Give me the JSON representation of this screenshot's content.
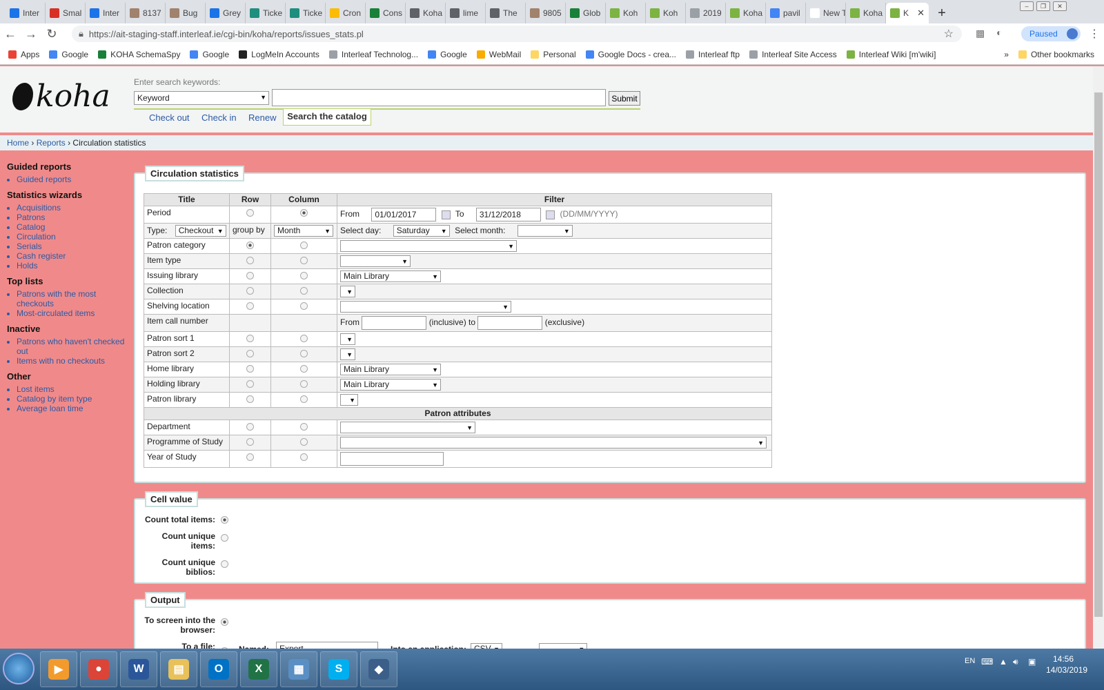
{
  "browser": {
    "tabs": [
      {
        "label": "Inter",
        "color": "#1a73e8"
      },
      {
        "label": "Smal",
        "color": "#d93025"
      },
      {
        "label": "Inter",
        "color": "#1a73e8"
      },
      {
        "label": "8137",
        "color": "#a0826d"
      },
      {
        "label": "Bug",
        "color": "#a0826d"
      },
      {
        "label": "Grey",
        "color": "#1a73e8"
      },
      {
        "label": "Ticke",
        "color": "#1e8e7e"
      },
      {
        "label": "Ticke",
        "color": "#1e8e7e"
      },
      {
        "label": "Cron",
        "color": "#fbbc04"
      },
      {
        "label": "Cons",
        "color": "#188038"
      },
      {
        "label": "Koha",
        "color": "#5f6368"
      },
      {
        "label": "lime",
        "color": "#5f6368"
      },
      {
        "label": "The",
        "color": "#5f6368"
      },
      {
        "label": "9805",
        "color": "#a0826d"
      },
      {
        "label": "Glob",
        "color": "#188038"
      },
      {
        "label": "Koh",
        "color": "#7cb342"
      },
      {
        "label": "Koh",
        "color": "#7cb342"
      },
      {
        "label": "2019",
        "color": "#9aa0a6"
      },
      {
        "label": "Koha",
        "color": "#7cb342"
      },
      {
        "label": "pavil",
        "color": "#4285f4"
      },
      {
        "label": "New Tab",
        "color": "#ffffff"
      },
      {
        "label": "Koha",
        "color": "#7cb342"
      }
    ],
    "active_tab": {
      "label": "K",
      "close": "✕"
    },
    "url": "https://ait-staging-staff.interleaf.ie/cgi-bin/koha/reports/issues_stats.pl",
    "paused_label": "Paused",
    "bookmarks": [
      {
        "label": "Apps",
        "icon": "apps-icon",
        "color": "#ea4335"
      },
      {
        "label": "Google",
        "icon": "google-icon",
        "color": "#4285f4"
      },
      {
        "label": "KOHA SchemaSpy",
        "icon": "koha-icon",
        "color": "#188038"
      },
      {
        "label": "Google",
        "icon": "google-icon",
        "color": "#4285f4"
      },
      {
        "label": "LogMeIn Accounts",
        "icon": "logmein-icon",
        "color": "#222222"
      },
      {
        "label": "Interleaf Technolog...",
        "icon": "page-icon",
        "color": "#9aa0a6"
      },
      {
        "label": "Google",
        "icon": "google-icon",
        "color": "#4285f4"
      },
      {
        "label": "WebMail",
        "icon": "webmail-icon",
        "color": "#f9ab00"
      },
      {
        "label": "Personal",
        "icon": "folder-icon",
        "color": "#fdd663"
      },
      {
        "label": "Google Docs - crea...",
        "icon": "docs-icon",
        "color": "#4285f4"
      },
      {
        "label": "Interleaf ftp",
        "icon": "page-icon",
        "color": "#9aa0a6"
      },
      {
        "label": "Interleaf Site Access",
        "icon": "page-icon",
        "color": "#9aa0a6"
      },
      {
        "label": "Interleaf Wiki [m'wiki]",
        "icon": "wiki-icon",
        "color": "#7cb342"
      }
    ],
    "other_bookmarks": "Other bookmarks",
    "more": "»"
  },
  "koha_header": {
    "logo_text": "koha",
    "search_label": "Enter search keywords:",
    "search_type": "Keyword",
    "submit_label": "Submit",
    "tabs": [
      "Check out",
      "Check in",
      "Renew"
    ],
    "active_tab": "Search the catalog"
  },
  "breadcrumb": {
    "home": "Home",
    "sep1": "›",
    "reports": "Reports",
    "sep2": "›",
    "current": "Circulation statistics"
  },
  "sidebar": {
    "sections": [
      {
        "heading": "Guided reports",
        "items": [
          "Guided reports"
        ]
      },
      {
        "heading": "Statistics wizards",
        "items": [
          "Acquisitions",
          "Patrons",
          "Catalog",
          "Circulation",
          "Serials",
          "Cash register",
          "Holds"
        ]
      },
      {
        "heading": "Top lists",
        "items": [
          "Patrons with the most checkouts",
          "Most-circulated items"
        ]
      },
      {
        "heading": "Inactive",
        "items": [
          "Patrons who haven't checked out",
          "Items with no checkouts"
        ]
      },
      {
        "heading": "Other",
        "items": [
          "Lost items",
          "Catalog by item type",
          "Average loan time"
        ]
      }
    ]
  },
  "circ_stats": {
    "legend": "Circulation statistics",
    "headers": {
      "title": "Title",
      "row": "Row",
      "column": "Column",
      "filter": "Filter"
    },
    "period": {
      "label": "Period",
      "from_label": "From",
      "from_value": "01/01/2017",
      "to_label": "To",
      "to_value": "31/12/2018",
      "format_hint": "(DD/MM/YYYY)"
    },
    "type_row": {
      "type_label": "Type:",
      "type_value": "Checkout",
      "group_by": "group by",
      "group_value": "Month",
      "select_day_label": "Select day:",
      "select_day_value": "Saturday",
      "select_month_label": "Select month:",
      "select_month_value": ""
    },
    "rows": {
      "patron_category": "Patron category",
      "item_type": "Item type",
      "issuing_library": "Issuing library",
      "issuing_library_value": "Main Library",
      "collection": "Collection",
      "shelving_location": "Shelving location",
      "item_call_number": "Item call number",
      "call_from": "From",
      "call_inclusive": "(inclusive) to",
      "call_exclusive": "(exclusive)",
      "patron_sort1": "Patron sort 1",
      "patron_sort2": "Patron sort 2",
      "home_library": "Home library",
      "home_library_value": "Main Library",
      "holding_library": "Holding library",
      "holding_library_value": "Main Library",
      "patron_library": "Patron library"
    },
    "patron_attributes": {
      "heading": "Patron attributes",
      "department": "Department",
      "programme": "Programme of Study",
      "year": "Year of Study"
    }
  },
  "cell_value": {
    "legend": "Cell value",
    "count_total": "Count total items:",
    "count_unique_items": "Count unique items:",
    "count_unique_biblios": "Count unique biblios:"
  },
  "output": {
    "legend": "Output",
    "to_screen": "To screen into the browser:",
    "to_file": "To a file:",
    "named_label": "Named:",
    "named_value": "Export",
    "into_app_label": "Into an application:",
    "app_value": "CSV",
    "delimiter_value": ","
  },
  "taskbar": {
    "lang": "EN",
    "time": "14:56",
    "date": "14/03/2019",
    "apps": [
      {
        "name": "windows-media-player-icon",
        "glyph": "▶",
        "color": "#f29b2c"
      },
      {
        "name": "chrome-icon",
        "glyph": "●",
        "color": "#db4437"
      },
      {
        "name": "word-icon",
        "glyph": "W",
        "color": "#2b579a"
      },
      {
        "name": "file-explorer-icon",
        "glyph": "▤",
        "color": "#e8c15a"
      },
      {
        "name": "outlook-icon",
        "glyph": "O",
        "color": "#0072c6"
      },
      {
        "name": "excel-icon",
        "glyph": "X",
        "color": "#217346"
      },
      {
        "name": "control-panel-icon",
        "glyph": "▦",
        "color": "#5a8fc4"
      },
      {
        "name": "skype-icon",
        "glyph": "S",
        "color": "#00aff0"
      },
      {
        "name": "sql-icon",
        "glyph": "◆",
        "color": "#3c5f8a"
      }
    ]
  }
}
